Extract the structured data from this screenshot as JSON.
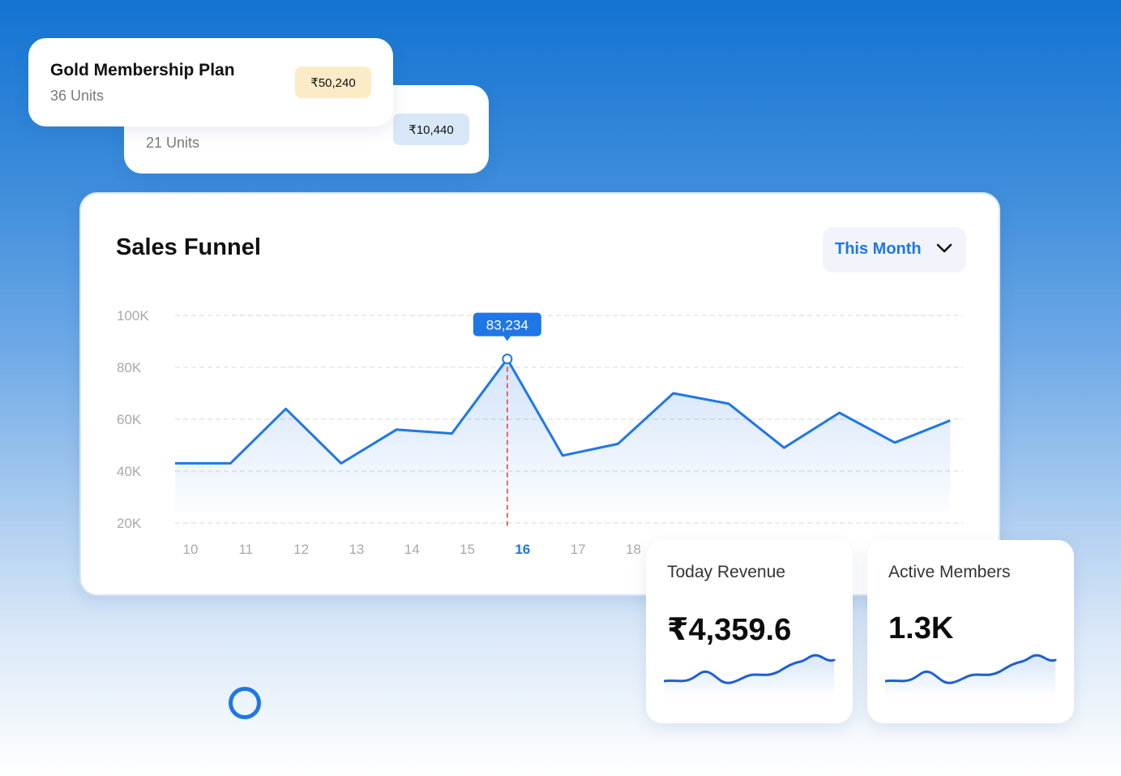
{
  "plans": [
    {
      "name": "Gold Membership Plan",
      "units": "36 Units",
      "price": "₹50,240"
    },
    {
      "name": "",
      "units": "21 Units",
      "price": "₹10,440"
    }
  ],
  "sales_funnel": {
    "title": "Sales Funnel",
    "period_select": {
      "value": "This Month"
    },
    "tooltip": "83,234",
    "colors": {
      "line": "#1f77e6",
      "highlight": "#e23b3b",
      "grid": "#e0e0e0"
    }
  },
  "chart_data": {
    "type": "area",
    "title": "Sales Funnel",
    "x_tick_labels": [
      "10",
      "11",
      "12",
      "13",
      "14",
      "15",
      "16",
      "17",
      "18"
    ],
    "x": [
      10,
      11,
      12,
      13,
      14,
      15,
      16,
      17,
      18,
      19,
      20,
      21,
      22,
      23,
      24
    ],
    "values": [
      43000,
      43000,
      64000,
      43000,
      56000,
      54500,
      83234,
      46000,
      50500,
      70000,
      66000,
      49000,
      62500,
      51000,
      59500
    ],
    "y_ticks": [
      "100K",
      "80K",
      "60K",
      "40K",
      "20K"
    ],
    "y_tick_values": [
      100000,
      80000,
      60000,
      40000,
      20000
    ],
    "ylim": [
      20000,
      100000
    ],
    "highlighted_x": 16,
    "grid": true
  },
  "stats": {
    "revenue": {
      "label": "Today Revenue",
      "value": "₹4,359.6"
    },
    "members": {
      "label": "Active Members",
      "value": "1.3K"
    }
  }
}
